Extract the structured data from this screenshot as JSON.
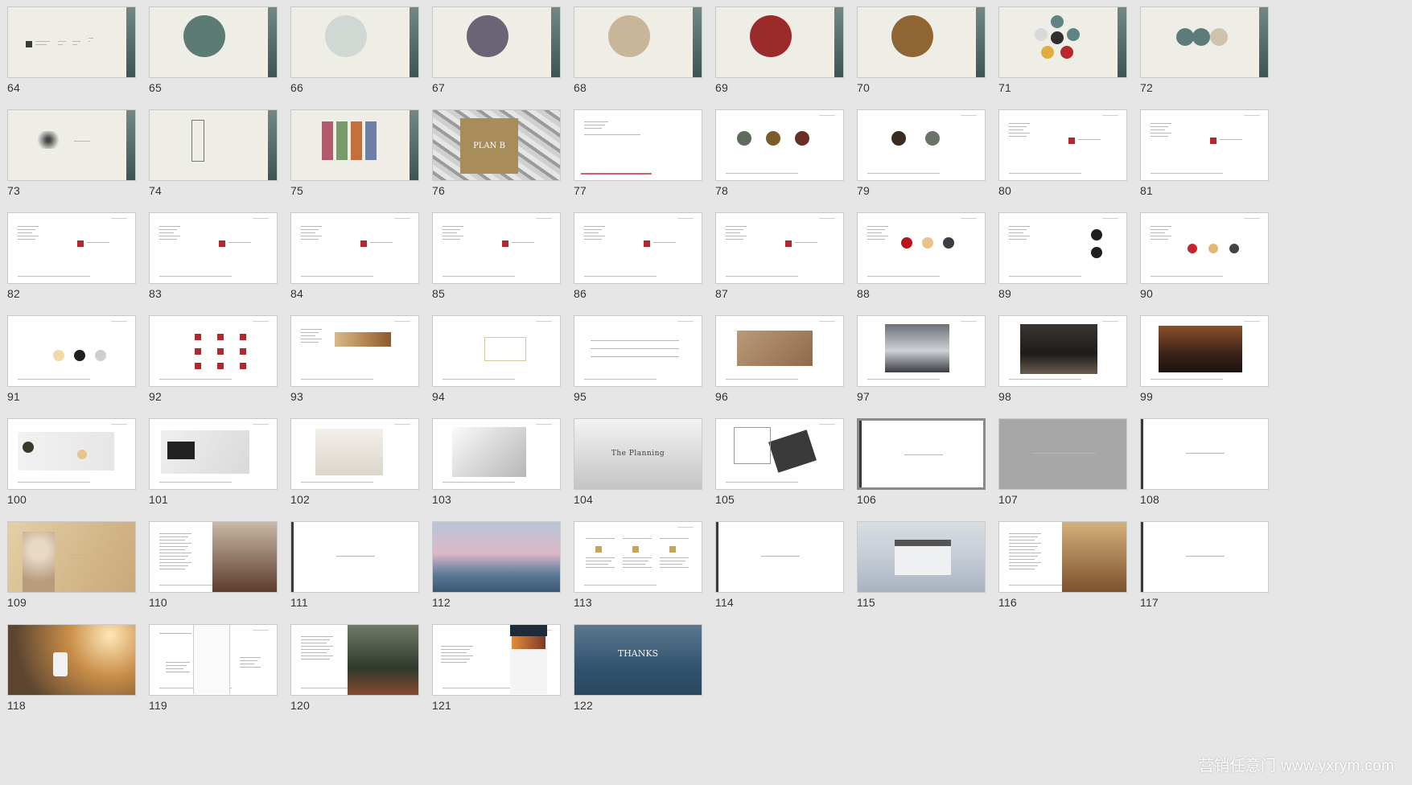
{
  "slides": [
    {
      "num": "64",
      "kind": "cream-logos"
    },
    {
      "num": "65",
      "kind": "cream-circle",
      "color": "#5c7b74"
    },
    {
      "num": "66",
      "kind": "cream-circle",
      "color": "#cfd8d2"
    },
    {
      "num": "67",
      "kind": "cream-circle",
      "color": "#6a6576"
    },
    {
      "num": "68",
      "kind": "cream-circle",
      "color": "#c8b59a"
    },
    {
      "num": "69",
      "kind": "cream-circle",
      "color": "#9c2a2a"
    },
    {
      "num": "70",
      "kind": "cream-circle",
      "color": "#8f6534"
    },
    {
      "num": "71",
      "kind": "cream-dots"
    },
    {
      "num": "72",
      "kind": "cream-three"
    },
    {
      "num": "73",
      "kind": "cream-branch"
    },
    {
      "num": "74",
      "kind": "cream-window"
    },
    {
      "num": "75",
      "kind": "cream-panels"
    },
    {
      "num": "76",
      "kind": "planb",
      "title": "PLAN B"
    },
    {
      "num": "77",
      "kind": "white-title"
    },
    {
      "num": "78",
      "kind": "white-three-circles"
    },
    {
      "num": "79",
      "kind": "white-two-circles"
    },
    {
      "num": "80",
      "kind": "white-logo"
    },
    {
      "num": "81",
      "kind": "white-logo"
    },
    {
      "num": "82",
      "kind": "white-logo"
    },
    {
      "num": "83",
      "kind": "white-logo"
    },
    {
      "num": "84",
      "kind": "white-logo"
    },
    {
      "num": "85",
      "kind": "white-logo"
    },
    {
      "num": "86",
      "kind": "white-vertical"
    },
    {
      "num": "87",
      "kind": "white-vertical"
    },
    {
      "num": "88",
      "kind": "white-colors"
    },
    {
      "num": "89",
      "kind": "white-black-dots"
    },
    {
      "num": "90",
      "kind": "white-colors-four"
    },
    {
      "num": "91",
      "kind": "white-swatches"
    },
    {
      "num": "92",
      "kind": "white-logo-grid"
    },
    {
      "num": "93",
      "kind": "white-wood"
    },
    {
      "num": "94",
      "kind": "white-lines"
    },
    {
      "num": "95",
      "kind": "white-table"
    },
    {
      "num": "96",
      "kind": "white-woodsign"
    },
    {
      "num": "97",
      "kind": "white-interior"
    },
    {
      "num": "98",
      "kind": "white-interior-dark"
    },
    {
      "num": "99",
      "kind": "white-interior-lobby"
    },
    {
      "num": "100",
      "kind": "white-products"
    },
    {
      "num": "101",
      "kind": "white-boxes"
    },
    {
      "num": "102",
      "kind": "white-bag"
    },
    {
      "num": "103",
      "kind": "white-bags"
    },
    {
      "num": "104",
      "kind": "planning",
      "title": "The Planning"
    },
    {
      "num": "105",
      "kind": "white-book"
    },
    {
      "num": "106",
      "kind": "white-divider",
      "selected": true
    },
    {
      "num": "107",
      "kind": "gray-divider"
    },
    {
      "num": "108",
      "kind": "white-divider"
    },
    {
      "num": "109",
      "kind": "photo-warm"
    },
    {
      "num": "110",
      "kind": "white-photo-right"
    },
    {
      "num": "111",
      "kind": "white-divider-text"
    },
    {
      "num": "112",
      "kind": "photo-city"
    },
    {
      "num": "113",
      "kind": "white-three-cols"
    },
    {
      "num": "114",
      "kind": "white-divider-text"
    },
    {
      "num": "115",
      "kind": "photo-mist"
    },
    {
      "num": "116",
      "kind": "white-photo-right2"
    },
    {
      "num": "117",
      "kind": "white-divider-text"
    },
    {
      "num": "118",
      "kind": "photo-sun"
    },
    {
      "num": "119",
      "kind": "white-phone-lines"
    },
    {
      "num": "120",
      "kind": "white-photo-garden"
    },
    {
      "num": "121",
      "kind": "white-phone-ui"
    },
    {
      "num": "122",
      "kind": "sea",
      "title": "THANKS"
    }
  ],
  "watermark": "营销任意门 www.yxrym.com"
}
